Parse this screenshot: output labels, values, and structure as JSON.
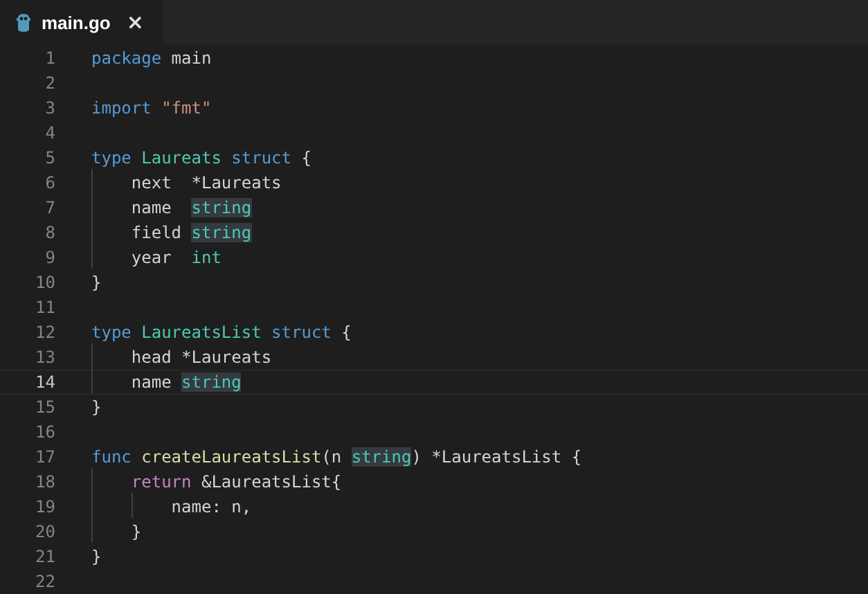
{
  "tab": {
    "title": "main.go",
    "close": "×",
    "selected": true
  },
  "lines": [
    {
      "number": "1",
      "current": false,
      "tokens": [
        {
          "kind": "keyword",
          "text": "package"
        },
        {
          "kind": "plain",
          "text": " main"
        }
      ]
    },
    {
      "number": "2",
      "current": false
    },
    {
      "number": "3",
      "current": false,
      "tokens": [
        {
          "kind": "keyword",
          "text": "import "
        },
        {
          "kind": "string",
          "text": "\"fmt\""
        }
      ]
    },
    {
      "number": "4",
      "current": false
    },
    {
      "number": "5",
      "current": false,
      "tokens": [
        {
          "kind": "keyword",
          "text": "type "
        },
        {
          "kind": "type",
          "text": "Laureats "
        },
        {
          "kind": "keyword",
          "text": "struct"
        },
        {
          "kind": "plain",
          "text": " {"
        }
      ]
    },
    {
      "number": "6",
      "current": false,
      "tokens": [
        {
          "kind": "plain",
          "text": "    next  *Laureats"
        }
      ]
    },
    {
      "number": "7",
      "current": false,
      "tokens": [
        {
          "kind": "plain",
          "text": "    name  "
        },
        {
          "kind": "type",
          "text": "string",
          "highlighted": true
        }
      ]
    },
    {
      "number": "8",
      "current": false,
      "tokens": [
        {
          "kind": "plain",
          "text": "    field "
        },
        {
          "kind": "type",
          "text": "string",
          "highlighted": true
        }
      ]
    },
    {
      "number": "9",
      "current": false,
      "tokens": [
        {
          "kind": "plain",
          "text": "    year  "
        },
        {
          "kind": "type",
          "text": "int"
        }
      ]
    },
    {
      "number": "10",
      "current": false,
      "tokens": [
        {
          "kind": "plain",
          "text": "}"
        }
      ]
    },
    {
      "number": "11",
      "current": false
    },
    {
      "number": "12",
      "current": false,
      "tokens": [
        {
          "kind": "keyword",
          "text": "type "
        },
        {
          "kind": "type",
          "text": "LaureatsList "
        },
        {
          "kind": "keyword",
          "text": "struct"
        },
        {
          "kind": "plain",
          "text": " {"
        }
      ]
    },
    {
      "number": "13",
      "current": false,
      "tokens": [
        {
          "kind": "plain",
          "text": "    head *Laureats"
        }
      ]
    },
    {
      "number": "14",
      "current": true,
      "tokens": [
        {
          "kind": "plain",
          "text": "    name "
        },
        {
          "kind": "type",
          "text": "string",
          "highlighted": true
        }
      ]
    },
    {
      "number": "15",
      "current": false,
      "tokens": [
        {
          "kind": "plain",
          "text": "}"
        }
      ]
    },
    {
      "number": "16",
      "current": false
    },
    {
      "number": "17",
      "current": false,
      "tokens": [
        {
          "kind": "keyword",
          "text": "func "
        },
        {
          "kind": "function",
          "text": "createLaureatsList"
        },
        {
          "kind": "plain",
          "text": "(n "
        },
        {
          "kind": "type",
          "text": "string",
          "highlighted": true
        },
        {
          "kind": "plain",
          "text": ") *LaureatsList {"
        }
      ]
    },
    {
      "number": "18",
      "current": false,
      "tokens": [
        {
          "kind": "control",
          "text": "    return"
        },
        {
          "kind": "plain",
          "text": " &LaureatsList{"
        }
      ]
    },
    {
      "number": "19",
      "current": false,
      "tokens": [
        {
          "kind": "plain",
          "text": "        name: n,"
        }
      ]
    },
    {
      "number": "20",
      "current": false,
      "tokens": [
        {
          "kind": "plain",
          "text": "    }"
        }
      ]
    },
    {
      "number": "21",
      "current": false,
      "tokens": [
        {
          "kind": "plain",
          "text": "}"
        }
      ]
    },
    {
      "number": "22",
      "current": false
    }
  ]
}
